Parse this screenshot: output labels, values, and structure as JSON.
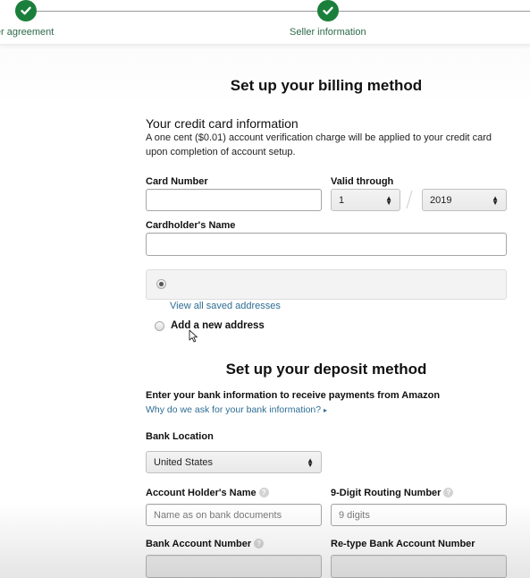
{
  "stepper": {
    "steps": [
      {
        "label": "ller agreement",
        "status": "completed"
      },
      {
        "label": "Seller information",
        "status": "completed"
      }
    ],
    "check_color": "#1a7f3a"
  },
  "billing": {
    "title": "Set up your billing method",
    "subtitle": "Your credit card information",
    "description": "A one cent ($0.01) account verification charge will be applied to your credit card upon completion of account setup.",
    "card_number": {
      "label": "Card Number",
      "value": ""
    },
    "valid_through": {
      "label": "Valid through",
      "month": "1",
      "year": "2019",
      "separator": "/"
    },
    "cardholder_name": {
      "label": "Cardholder's Name",
      "value": ""
    },
    "saved_address": {
      "selected": true,
      "text": ""
    },
    "view_saved_link": "View all saved addresses",
    "add_new_address": {
      "label": "Add a new address",
      "selected": false
    }
  },
  "deposit": {
    "title": "Set up your deposit method",
    "intro": "Enter your bank information to receive payments from Amazon",
    "why_link": "Why do we ask for your bank information?",
    "why_link_arrow": "▸",
    "bank_location": {
      "label": "Bank Location",
      "value": "United States"
    },
    "account_holder": {
      "label": "Account Holder's Name",
      "placeholder": "Name as on bank documents",
      "help": "?"
    },
    "routing_number": {
      "label": "9-Digit Routing Number",
      "placeholder": "9 digits",
      "help": "?"
    },
    "account_number": {
      "label": "Bank Account Number",
      "value": "",
      "help": "?"
    },
    "retype_account_number": {
      "label": "Re-type Bank Account Number",
      "value": ""
    }
  },
  "colors": {
    "link": "#2d6d93",
    "success": "#1a7f3a"
  }
}
